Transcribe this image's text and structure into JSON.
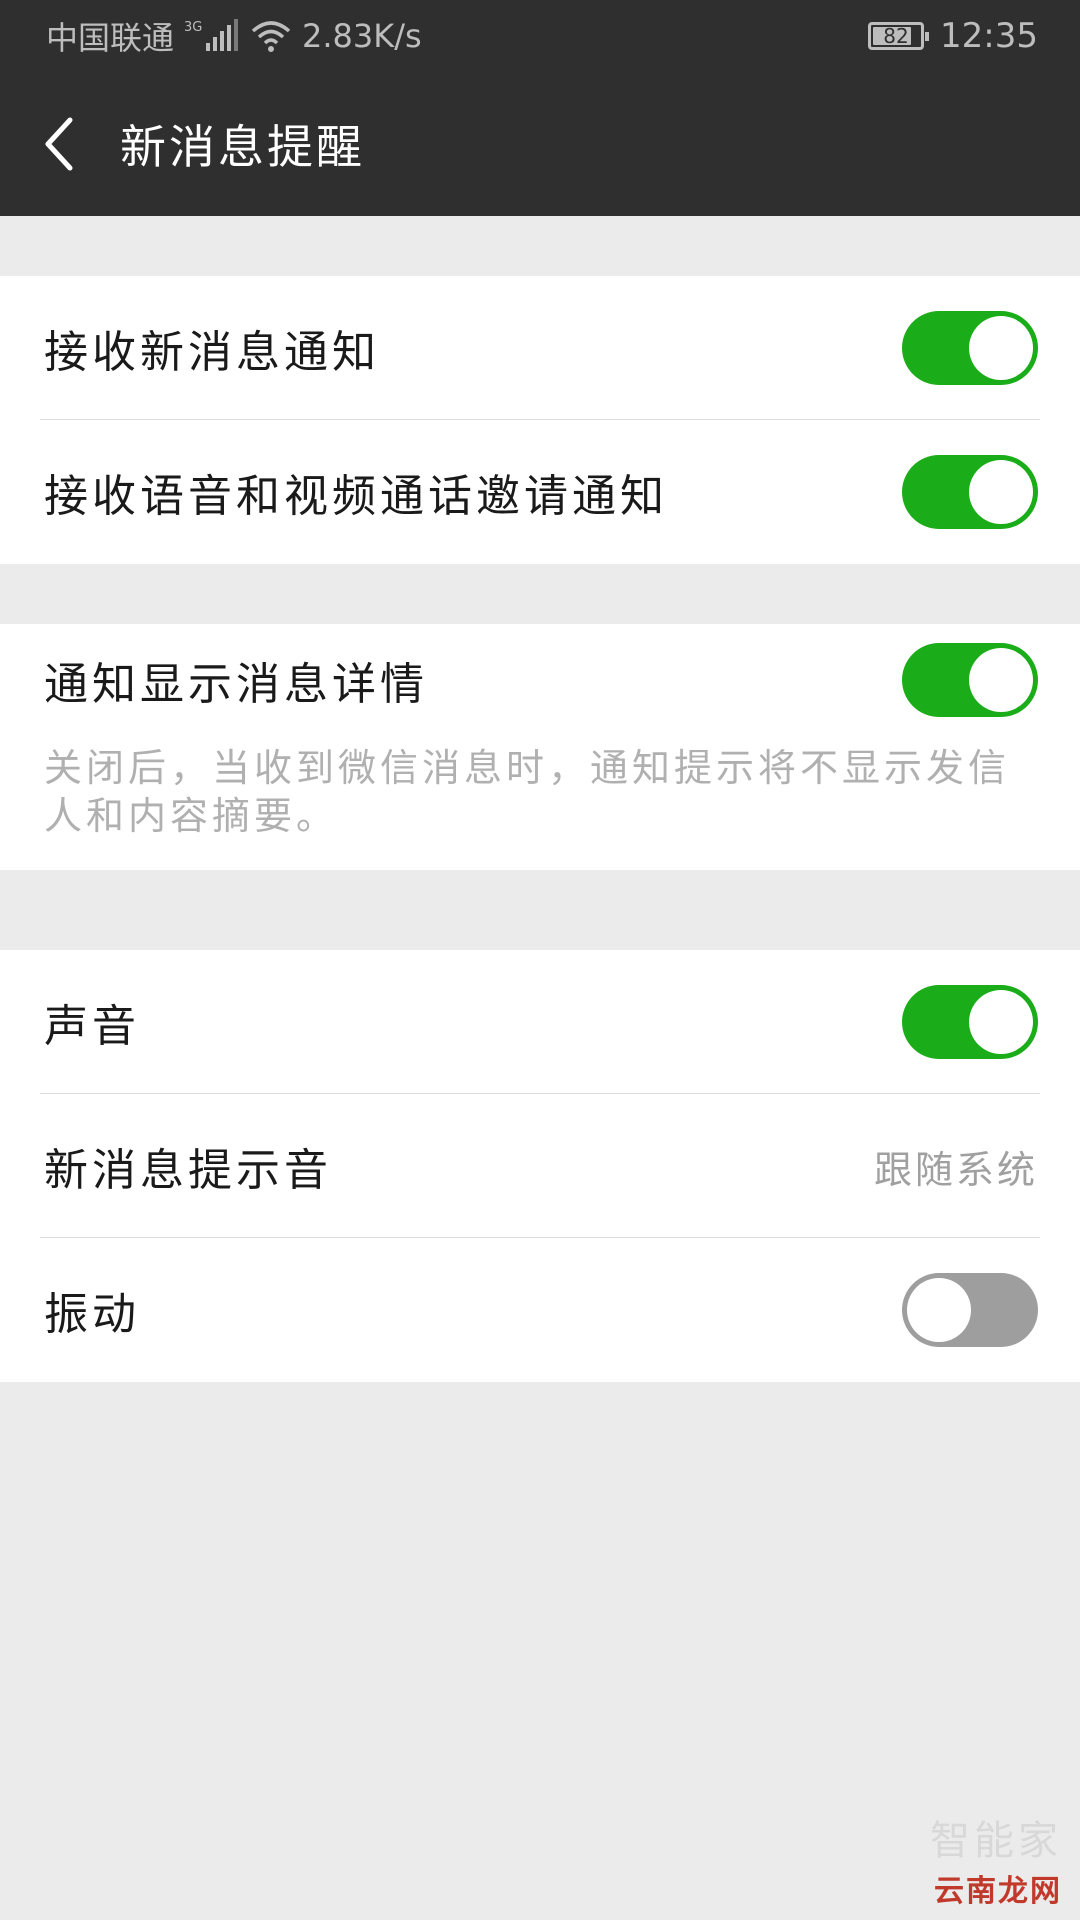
{
  "status_bar": {
    "carrier": "中国联通",
    "network_type": "3G",
    "speed": "2.83K/s",
    "battery": "82",
    "battery_level": 0.82,
    "time": "12:35"
  },
  "header": {
    "title": "新消息提醒",
    "back_icon": "chevron-left-icon"
  },
  "groups": [
    {
      "items": [
        {
          "label": "接收新消息通知",
          "toggle": true
        },
        {
          "label": "接收语音和视频通话邀请通知",
          "toggle": true
        }
      ]
    },
    {
      "items": [
        {
          "label": "通知显示消息详情",
          "toggle": true
        }
      ],
      "hint": "关闭后，当收到微信消息时，通知提示将不显示发信人和内容摘要。"
    },
    {
      "items": [
        {
          "label": "声音",
          "toggle": true
        },
        {
          "label": "新消息提示音",
          "value": "跟随系统"
        },
        {
          "label": "振动",
          "toggle": false
        }
      ]
    }
  ],
  "watermark": {
    "faint_text": "智能家",
    "logo_text": "云南龙网"
  },
  "colors": {
    "header_bg": "#2f2f2f",
    "toggle_on": "#1aad19",
    "toggle_off": "#9e9e9e",
    "page_bg": "#ebebeb"
  }
}
